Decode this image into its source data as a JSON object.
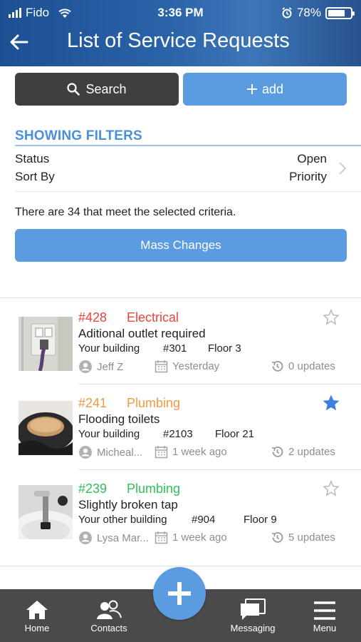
{
  "status_bar": {
    "carrier": "Fido",
    "time": "3:36 PM",
    "battery": "78%",
    "battery_level": 0.78
  },
  "header": {
    "title": "List of Service Requests"
  },
  "actions": {
    "search_label": "Search",
    "add_label": "add"
  },
  "filters": {
    "heading": "SHOWING FILTERS",
    "rows": [
      {
        "label": "Status",
        "value": "Open"
      },
      {
        "label": "Sort By",
        "value": "Priority"
      }
    ],
    "criteria_text": "There are 34 that meet the selected criteria.",
    "mass_changes_label": "Mass Changes"
  },
  "requests": [
    {
      "number": "#428",
      "category": "Electrical",
      "color": "#e8453c",
      "description": "Aditional outlet required",
      "building": "Your building",
      "unit": "#301",
      "floor": "Floor 3",
      "person": "Jeff Z",
      "date": "Yesterday",
      "updates": "0 updates",
      "starred": false
    },
    {
      "number": "#241",
      "category": "Plumbing",
      "color": "#f09a43",
      "description": "Flooding toilets",
      "building": "Your building",
      "unit": "#2103",
      "floor": "Floor 21",
      "person": "Micheal...",
      "date": "1 week ago",
      "updates": "2 updates",
      "starred": true
    },
    {
      "number": "#239",
      "category": "Plumbing",
      "color": "#2fc05a",
      "description": "Slightly broken tap",
      "building": "Your other building",
      "unit": "#904",
      "floor": "Floor 9",
      "person": "Lysa Mar...",
      "date": "1 week ago",
      "updates": "5 updates",
      "starred": false
    }
  ],
  "bottom_nav": {
    "home": "Home",
    "contacts": "Contacts",
    "messaging": "Messaging",
    "menu": "Menu"
  },
  "colors": {
    "accent": "#5b9be0",
    "header": "#2a62a8",
    "star_active": "#3b82e0",
    "nav_bg": "#4a4a4a"
  }
}
